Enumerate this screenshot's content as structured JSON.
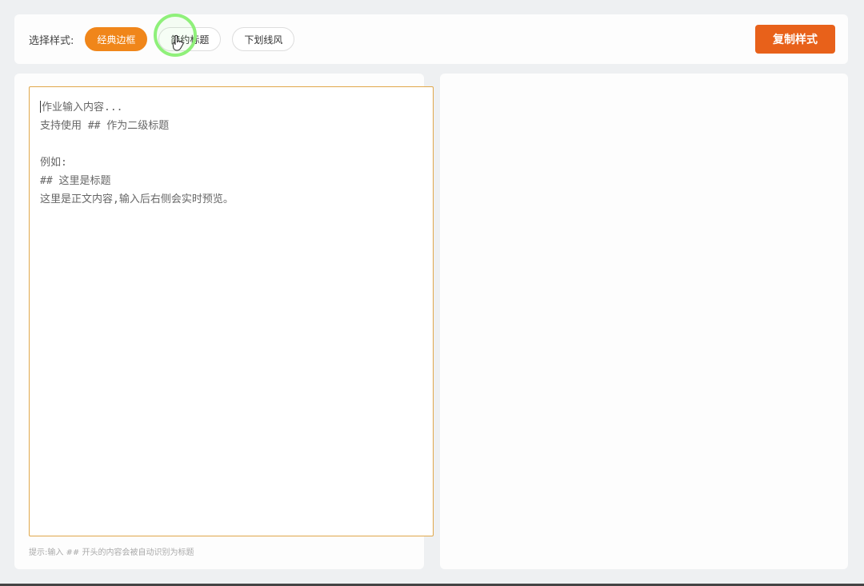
{
  "toolbar": {
    "label": "选择样式:",
    "styles": [
      {
        "label": "经典边框",
        "active": true
      },
      {
        "label": "简约标题",
        "active": false
      },
      {
        "label": "下划线风",
        "active": false
      }
    ],
    "copy_label": "复制样式"
  },
  "editor": {
    "placeholder_lines": [
      "作业输入内容...",
      "支持使用 ## 作为二级标题",
      "",
      "例如:",
      "## 这里是标题",
      "这里是正文内容,输入后右侧会实时预览。"
    ]
  },
  "hint": "提示:输入 ## 开头的内容会被自动识别为标题",
  "colors": {
    "accent": "#f0861a",
    "copy_button": "#e8611a",
    "editor_border": "#e0a74a",
    "cursor_highlight": "#8ff07a"
  },
  "icons": {
    "cursor": "hand-pointer-icon"
  }
}
